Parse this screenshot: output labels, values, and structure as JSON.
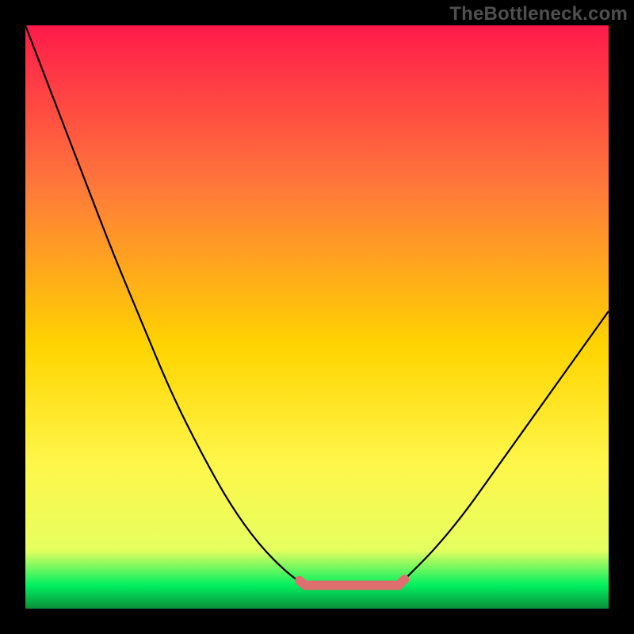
{
  "watermark": "TheBottleneck.com",
  "gradient": {
    "top": "#ff1a4a",
    "mid1": "#ff7a3a",
    "mid2": "#ffd400",
    "mid3": "#fff64a",
    "mid4": "#e6ff60",
    "bottom_band": "#00f060",
    "bottom_edge": "#0a8f3a"
  },
  "curve_color": "#000000",
  "floor_color": "#de6f6e",
  "chart_data": {
    "type": "line",
    "title": "",
    "xlabel": "",
    "ylabel": "",
    "x": [
      0.0,
      0.05,
      0.1,
      0.15,
      0.2,
      0.25,
      0.3,
      0.35,
      0.4,
      0.45,
      0.48,
      0.5,
      0.55,
      0.6,
      0.64,
      0.66,
      0.7,
      0.75,
      0.8,
      0.85,
      0.9,
      0.95,
      1.0
    ],
    "y": [
      1.0,
      0.87,
      0.74,
      0.61,
      0.49,
      0.37,
      0.27,
      0.18,
      0.11,
      0.06,
      0.04,
      0.04,
      0.04,
      0.04,
      0.04,
      0.06,
      0.1,
      0.16,
      0.23,
      0.3,
      0.37,
      0.44,
      0.51
    ],
    "xlim": [
      0,
      1
    ],
    "ylim": [
      0,
      1
    ],
    "floor_segment": {
      "x_start": 0.48,
      "x_end": 0.64,
      "y": 0.04
    }
  }
}
